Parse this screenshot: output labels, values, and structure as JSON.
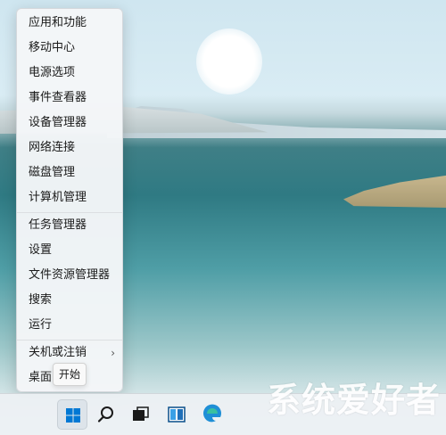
{
  "context_menu": {
    "groups": [
      [
        "应用和功能",
        "移动中心",
        "电源选项",
        "事件查看器",
        "设备管理器",
        "网络连接",
        "磁盘管理",
        "计算机管理"
      ],
      [
        "任务管理器",
        "设置",
        "文件资源管理器",
        "搜索",
        "运行"
      ],
      [
        "关机或注销",
        "桌面"
      ]
    ],
    "submenu_arrow": "›"
  },
  "tooltip": {
    "text": "开始"
  },
  "taskbar": {
    "start_icon": "windows-start-icon",
    "search_icon": "search-icon",
    "task_view_icon": "task-view-icon",
    "widgets_icon": "widgets-icon",
    "edge_icon": "edge-icon"
  },
  "watermark": {
    "text": "系统爱好者"
  },
  "colors": {
    "menu_bg": "#f4f6f8",
    "taskbar_bg": "#ecf0f3",
    "windows_blue": "#0078d4"
  }
}
